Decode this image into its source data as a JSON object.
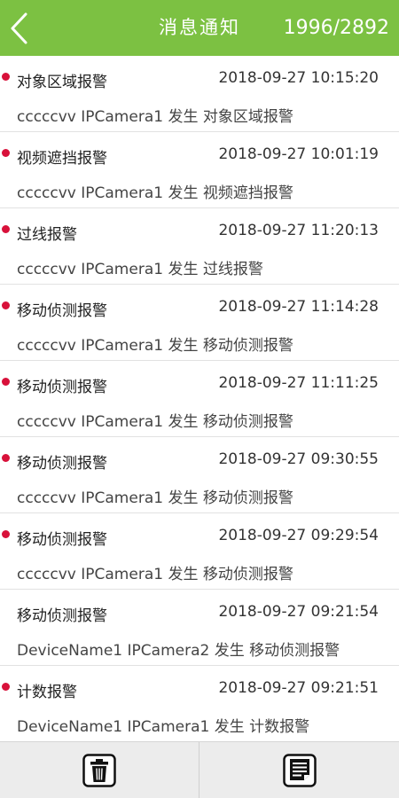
{
  "header": {
    "title": "消息通知",
    "count": "1996/2892",
    "back_icon": "chevron-left-icon",
    "bg_color": "#7cc142"
  },
  "unread_color": "#d8113a",
  "messages": [
    {
      "type": "对象区域报警",
      "time": "2018-09-27 10:15:20",
      "desc": "cccccvv IPCamera1 发生 对象区域报警",
      "unread": true
    },
    {
      "type": "视频遮挡报警",
      "time": "2018-09-27 10:01:19",
      "desc": "cccccvv IPCamera1 发生 视频遮挡报警",
      "unread": true
    },
    {
      "type": "过线报警",
      "time": "2018-09-27 11:20:13",
      "desc": "cccccvv IPCamera1 发生 过线报警",
      "unread": true
    },
    {
      "type": "移动侦测报警",
      "time": "2018-09-27 11:14:28",
      "desc": "cccccvv IPCamera1 发生 移动侦测报警",
      "unread": true
    },
    {
      "type": "移动侦测报警",
      "time": "2018-09-27 11:11:25",
      "desc": "cccccvv IPCamera1 发生 移动侦测报警",
      "unread": true
    },
    {
      "type": "移动侦测报警",
      "time": "2018-09-27 09:30:55",
      "desc": "cccccvv IPCamera1 发生 移动侦测报警",
      "unread": true
    },
    {
      "type": "移动侦测报警",
      "time": "2018-09-27 09:29:54",
      "desc": "cccccvv IPCamera1 发生 移动侦测报警",
      "unread": true
    },
    {
      "type": "移动侦测报警",
      "time": "2018-09-27 09:21:54",
      "desc": "DeviceName1 IPCamera2 发生 移动侦测报警",
      "unread": false
    },
    {
      "type": "计数报警",
      "time": "2018-09-27 09:21:51",
      "desc": "DeviceName1 IPCamera1 发生 计数报警",
      "unread": true
    }
  ],
  "toolbar": {
    "delete_icon": "trash-icon",
    "edit_icon": "edit-document-icon"
  }
}
